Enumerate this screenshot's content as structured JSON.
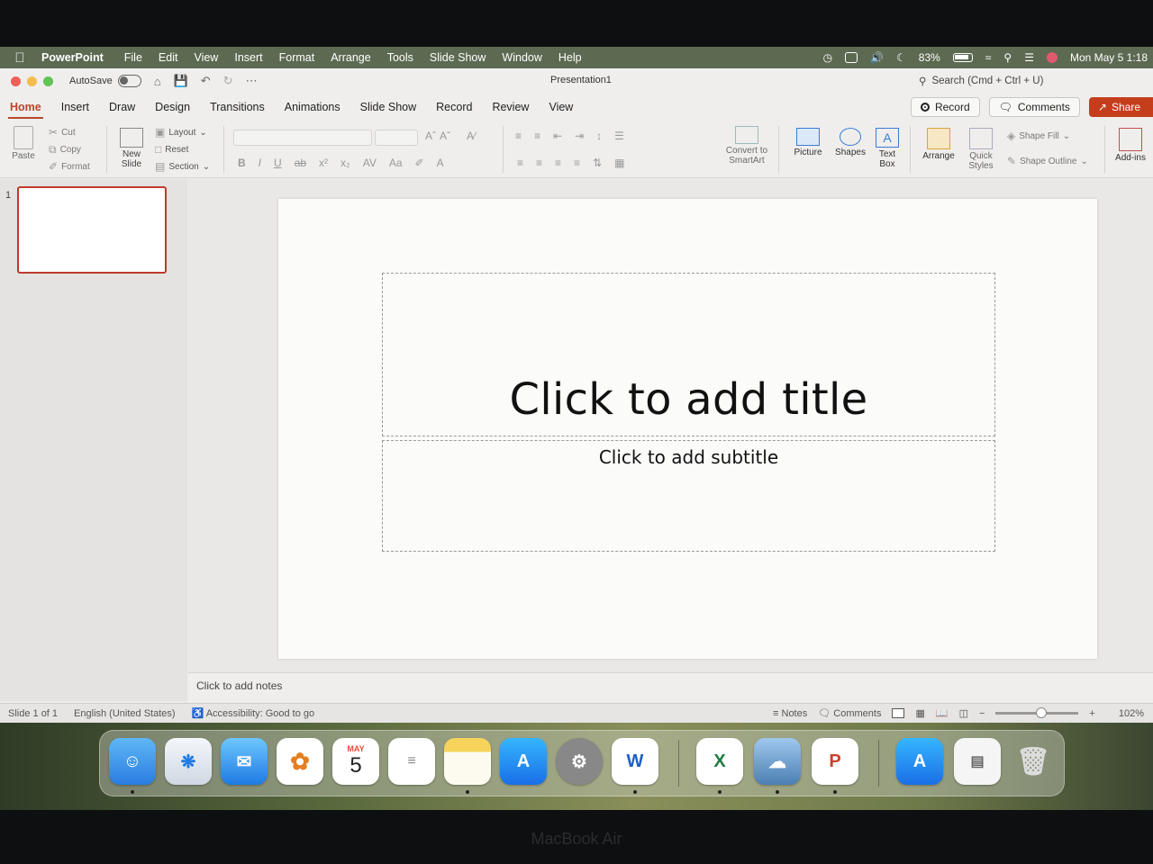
{
  "menubar": {
    "app_name": "PowerPoint",
    "items": [
      "File",
      "Edit",
      "View",
      "Insert",
      "Format",
      "Arrange",
      "Tools",
      "Slide Show",
      "Window",
      "Help"
    ],
    "battery": "83%",
    "clock": "Mon May 5  1:18"
  },
  "titlebar": {
    "autosave_label": "AutoSave",
    "doc_title": "Presentation1",
    "search_placeholder": "Search (Cmd + Ctrl + U)"
  },
  "ribbon_tabs": {
    "tabs": [
      "Home",
      "Insert",
      "Draw",
      "Design",
      "Transitions",
      "Animations",
      "Slide Show",
      "Record",
      "Review",
      "View"
    ],
    "active": "Home",
    "record_label": "Record",
    "comments_label": "Comments",
    "share_label": "Share"
  },
  "ribbon": {
    "paste": "Paste",
    "cut": "Cut",
    "copy": "Copy",
    "format": "Format",
    "new_slide_line1": "New",
    "new_slide_line2": "Slide",
    "layout": "Layout",
    "reset": "Reset",
    "section": "Section",
    "convert_line1": "Convert to",
    "convert_line2": "SmartArt",
    "picture": "Picture",
    "shapes": "Shapes",
    "textbox_line1": "Text",
    "textbox_line2": "Box",
    "arrange": "Arrange",
    "quick_styles_line1": "Quick",
    "quick_styles_line2": "Styles",
    "shape_fill": "Shape Fill",
    "shape_outline": "Shape Outline",
    "addins": "Add-ins"
  },
  "thumbnails": {
    "slide_number": "1"
  },
  "slide": {
    "title_placeholder": "Click to add title",
    "subtitle_placeholder": "Click to add subtitle"
  },
  "notes": {
    "placeholder": "Click to add notes"
  },
  "statusbar": {
    "slide_count": "Slide 1 of 1",
    "language": "English (United States)",
    "accessibility": "Accessibility: Good to go",
    "notes": "Notes",
    "comments": "Comments",
    "zoom_minus": "−",
    "zoom_plus": "+",
    "zoom": "102%",
    "zoom_level": 0.55
  },
  "dock": {
    "calendar_month": "MAY",
    "calendar_day": "5"
  },
  "bezel": {
    "label": "MacBook Air"
  }
}
